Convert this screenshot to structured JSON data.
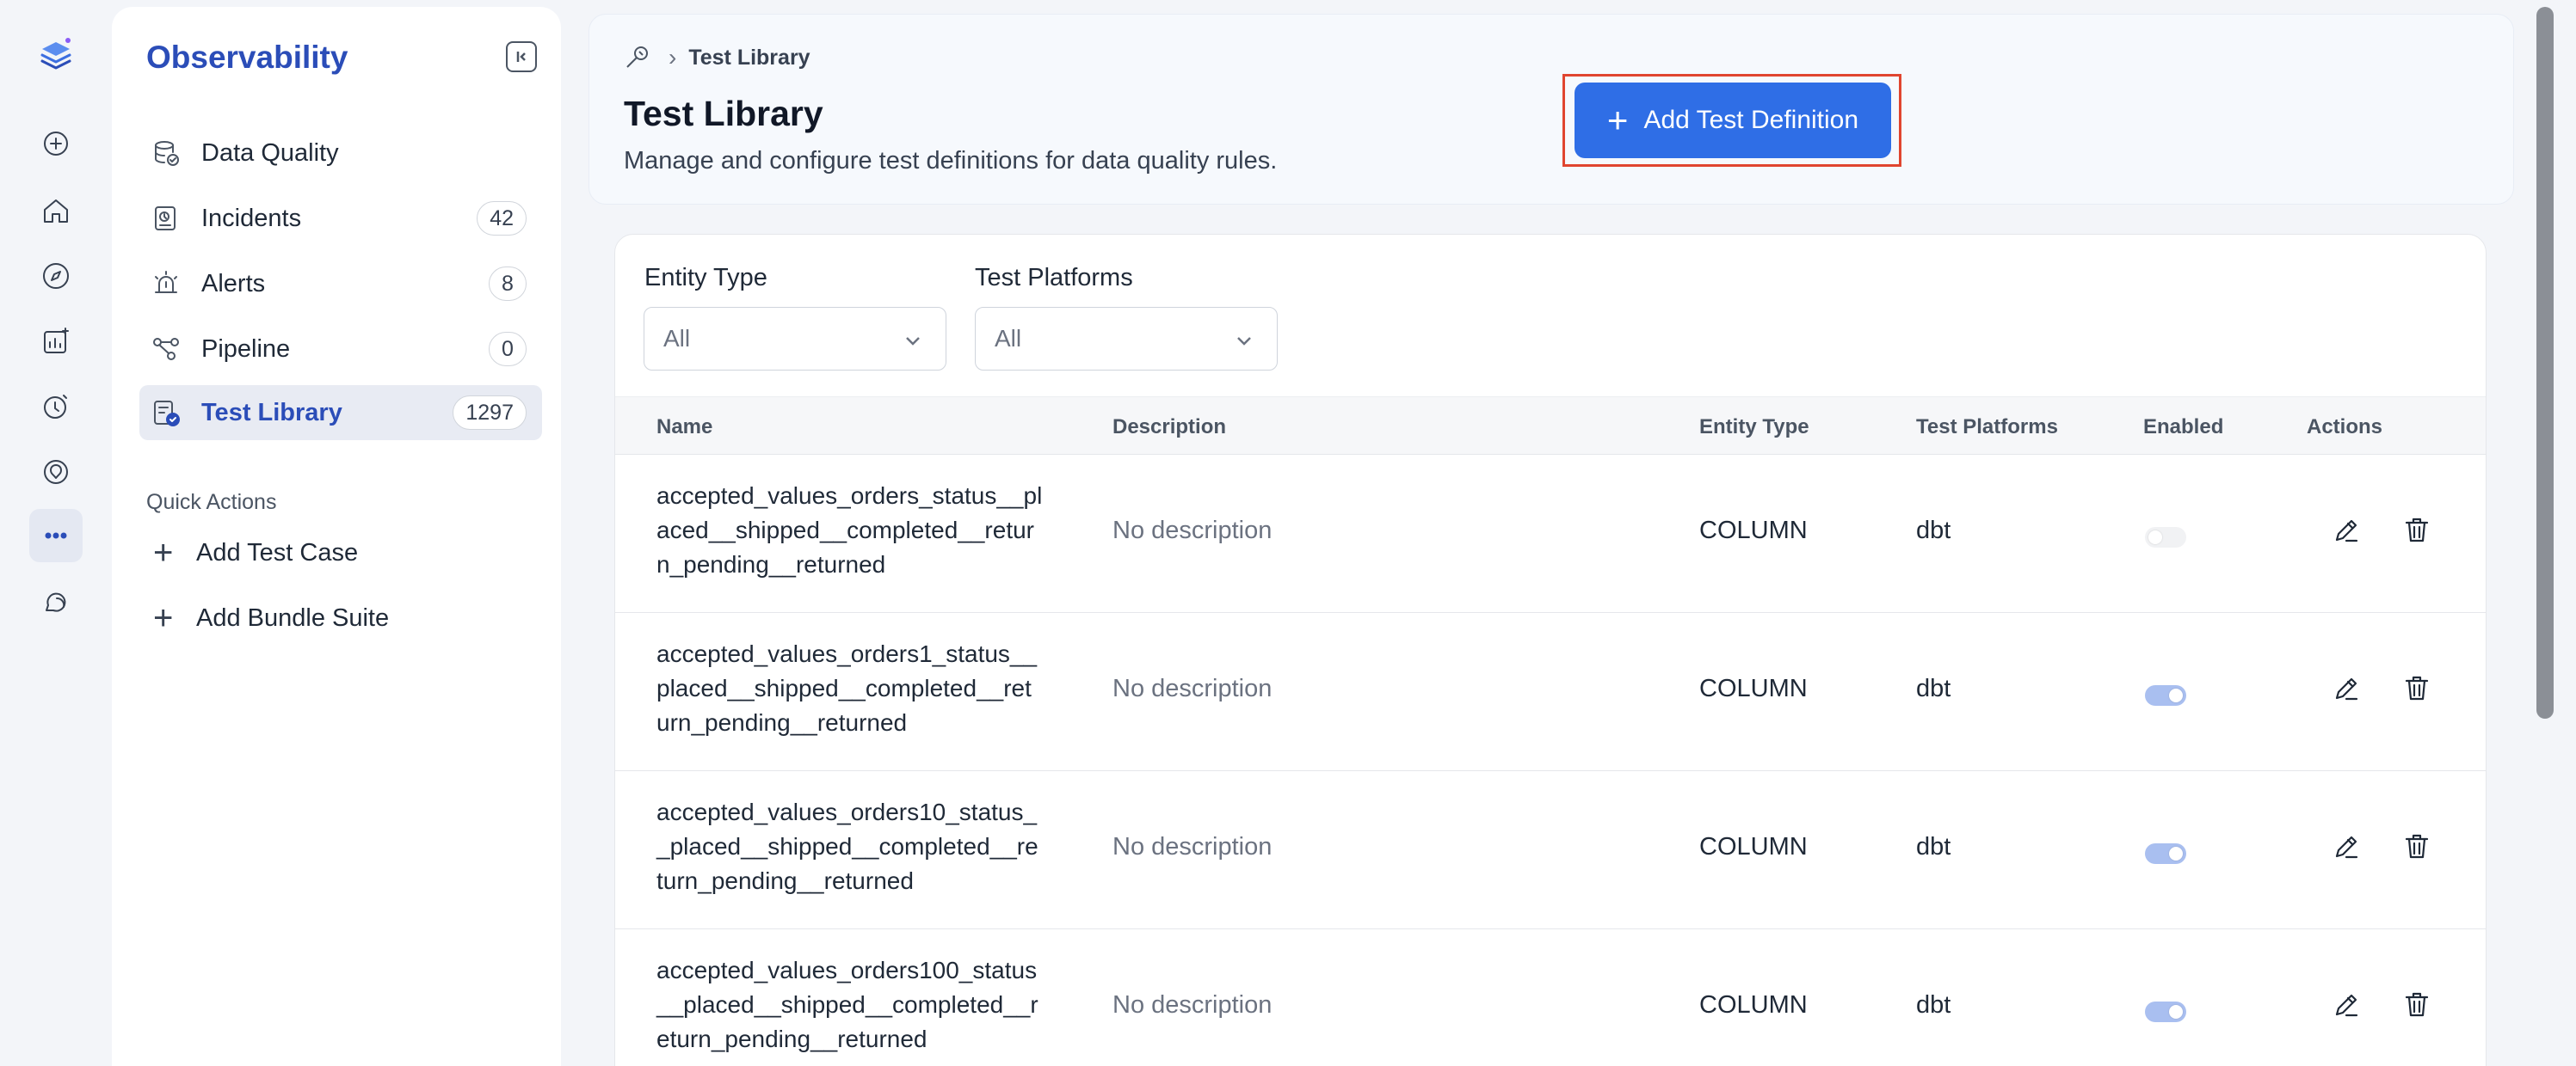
{
  "sidebar": {
    "title": "Observability",
    "items": [
      {
        "label": "Data Quality",
        "badge": null
      },
      {
        "label": "Incidents",
        "badge": "42"
      },
      {
        "label": "Alerts",
        "badge": "8"
      },
      {
        "label": "Pipeline",
        "badge": "0"
      },
      {
        "label": "Test Library",
        "badge": "1297"
      }
    ],
    "quick_actions_title": "Quick Actions",
    "quick_actions": [
      "Add Test Case",
      "Add Bundle Suite"
    ]
  },
  "header": {
    "breadcrumb": "Test Library",
    "title": "Test Library",
    "subtitle": "Manage and configure test definitions for data quality rules.",
    "add_button": "Add Test Definition"
  },
  "filters": {
    "entity_type_label": "Entity Type",
    "entity_type_value": "All",
    "platforms_label": "Test Platforms",
    "platforms_value": "All"
  },
  "table": {
    "columns": [
      "Name",
      "Description",
      "Entity Type",
      "Test Platforms",
      "Enabled",
      "Actions"
    ],
    "rows": [
      {
        "name": "accepted_values_orders_status__placed__shipped__completed__return_pending__returned",
        "description": "No description",
        "entity_type": "COLUMN",
        "platform": "dbt",
        "enabled": false
      },
      {
        "name": "accepted_values_orders1_status__placed__shipped__completed__return_pending__returned",
        "description": "No description",
        "entity_type": "COLUMN",
        "platform": "dbt",
        "enabled": true
      },
      {
        "name": "accepted_values_orders10_status__placed__shipped__completed__return_pending__returned",
        "description": "No description",
        "entity_type": "COLUMN",
        "platform": "dbt",
        "enabled": true
      },
      {
        "name": "accepted_values_orders100_status__placed__shipped__completed__return_pending__returned",
        "description": "No description",
        "entity_type": "COLUMN",
        "platform": "dbt",
        "enabled": true
      }
    ]
  },
  "colors": {
    "brand": "#2b4db8",
    "primary_button": "#2f6ee6",
    "highlight_frame": "#e0452f",
    "toggle_on": "#a9bff0"
  }
}
